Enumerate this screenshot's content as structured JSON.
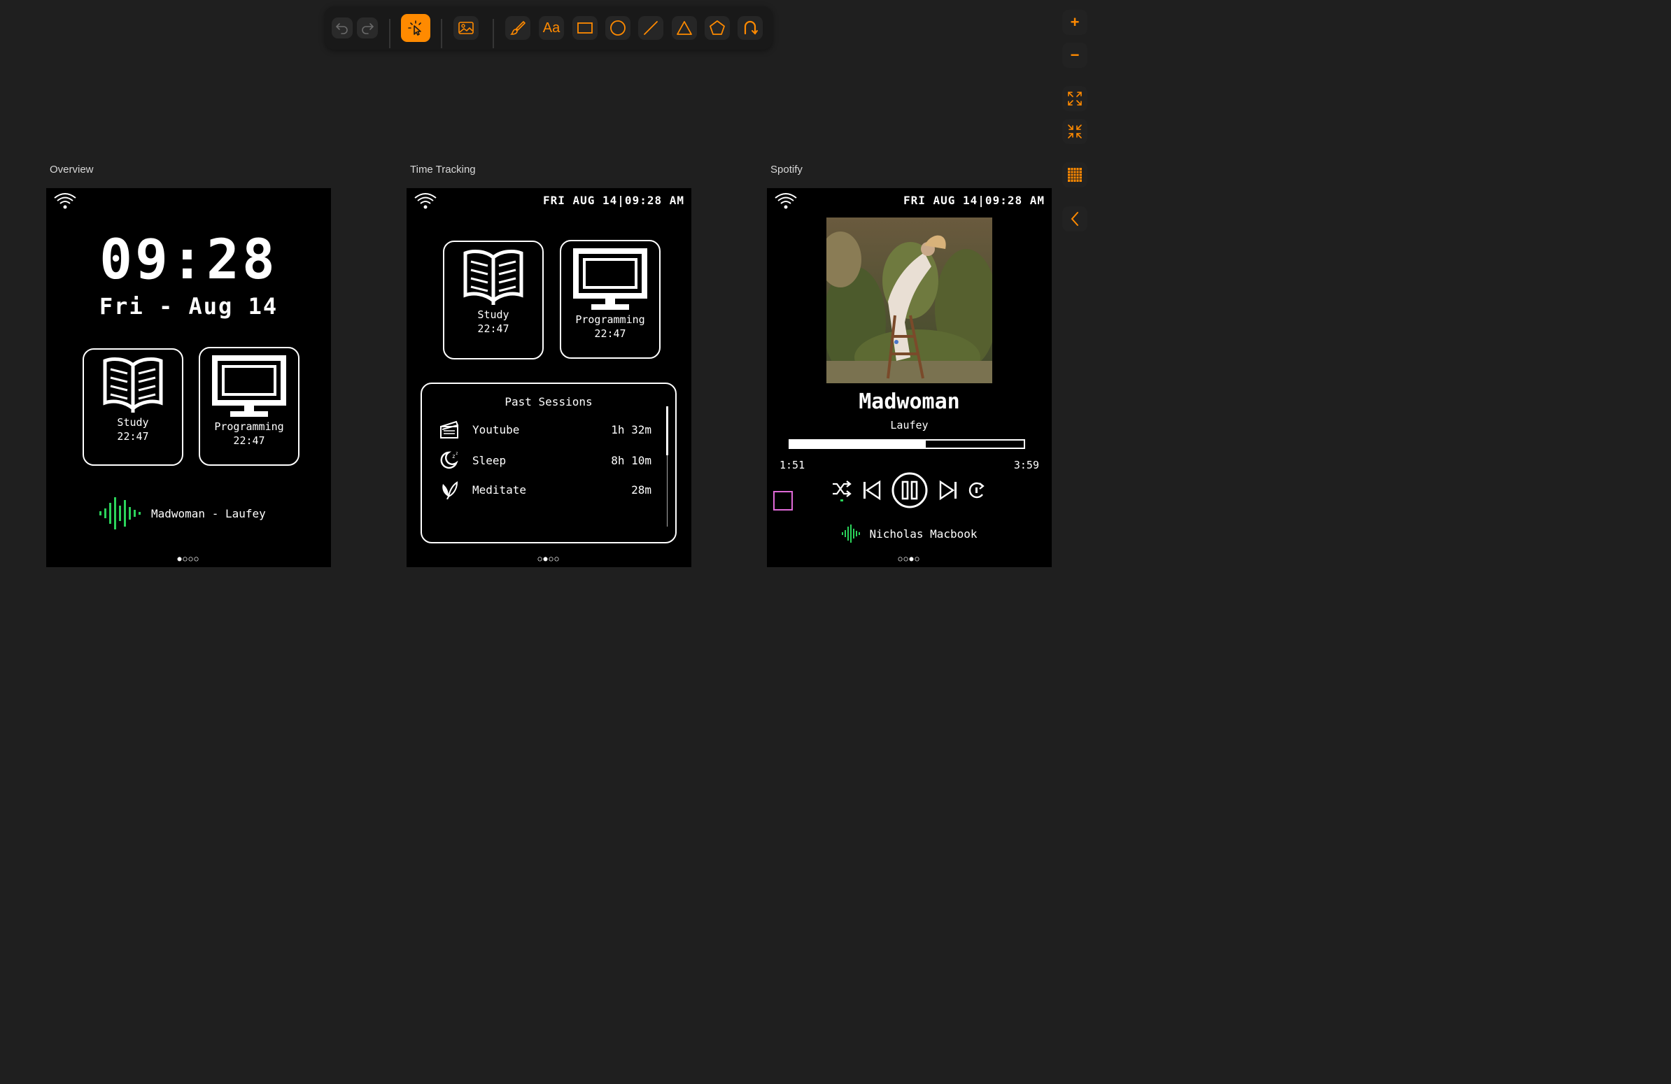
{
  "toolbar": {
    "tools": [
      "undo-icon",
      "redo-icon",
      "select-icon",
      "image-icon",
      "brush-icon",
      "text-tool",
      "rectangle-icon",
      "circle-icon",
      "line-icon",
      "triangle-icon",
      "pentagon-icon",
      "lasso-icon"
    ],
    "text_tool_label": "Aa",
    "accent": "#ff8a00"
  },
  "side_controls": {
    "zoom_in": "+",
    "zoom_out": "−"
  },
  "frames": {
    "overview": {
      "label": "Overview",
      "time": "09:28",
      "date": "Fri - Aug 14",
      "cards": [
        {
          "name": "Study",
          "time": "22:47"
        },
        {
          "name": "Programming",
          "time": "22:47"
        }
      ],
      "now_playing": "Madwoman - Laufey",
      "pager": "●○○○"
    },
    "time_tracking": {
      "label": "Time Tracking",
      "status": "FRI AUG 14|09:28 AM",
      "cards": [
        {
          "name": "Study",
          "time": "22:47"
        },
        {
          "name": "Programming",
          "time": "22:47"
        }
      ],
      "past_sessions": {
        "title": "Past Sessions",
        "rows": [
          {
            "icon": "clapperboard-icon",
            "name": "Youtube",
            "duration": "1h 32m"
          },
          {
            "icon": "moon-icon",
            "name": "Sleep",
            "duration": "8h 10m"
          },
          {
            "icon": "lotus-icon",
            "name": "Meditate",
            "duration": "28m"
          }
        ]
      },
      "pager": "○●○○"
    },
    "spotify": {
      "label": "Spotify",
      "status": "FRI AUG 14|09:28 AM",
      "song": "Madwoman",
      "artist": "Laufey",
      "progress": 0.58,
      "current_time": "1:51",
      "total_time": "3:59",
      "device": "Nicholas Macbook",
      "pager": "○○●○"
    }
  },
  "colors": {
    "canvas_bg": "#1f1f1f",
    "screen_bg": "#000000",
    "audio_green": "#2bd35a",
    "pink": "#e06ad8"
  }
}
